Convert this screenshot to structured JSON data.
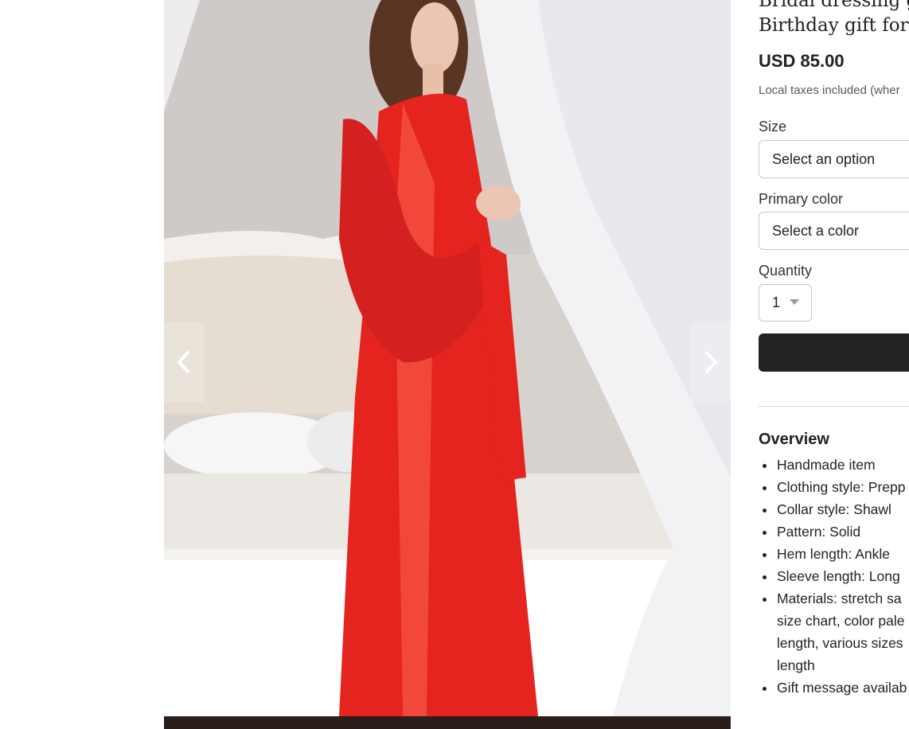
{
  "listing": {
    "title_lines": [
      "Bridal dressing go",
      "Birthday gift for s"
    ],
    "price": "USD 85.00",
    "tax_note": "Local taxes included (wher"
  },
  "options": {
    "size": {
      "label": "Size",
      "value": "Select an option"
    },
    "color": {
      "label": "Primary color",
      "value": "Select a color"
    },
    "quantity": {
      "label": "Quantity",
      "value": "1"
    }
  },
  "overview": {
    "heading": "Overview",
    "items": [
      {
        "lines": [
          "Handmade item"
        ]
      },
      {
        "lines": [
          "Clothing style: Prepp"
        ]
      },
      {
        "lines": [
          "Collar style: Shawl"
        ]
      },
      {
        "lines": [
          "Pattern: Solid"
        ]
      },
      {
        "lines": [
          "Hem length: Ankle"
        ]
      },
      {
        "lines": [
          "Sleeve length: Long"
        ]
      },
      {
        "lines": [
          "Materials: stretch sa",
          "size chart, color pale",
          "length, various sizes",
          "length"
        ]
      },
      {
        "lines": [
          "Gift message availab"
        ]
      }
    ]
  },
  "gallery": {
    "prev_icon": "chevron-left-icon",
    "next_icon": "chevron-right-icon"
  },
  "colors": {
    "robe": "#e5231f",
    "button": "#222222",
    "curtain": "#f2f1f4"
  }
}
